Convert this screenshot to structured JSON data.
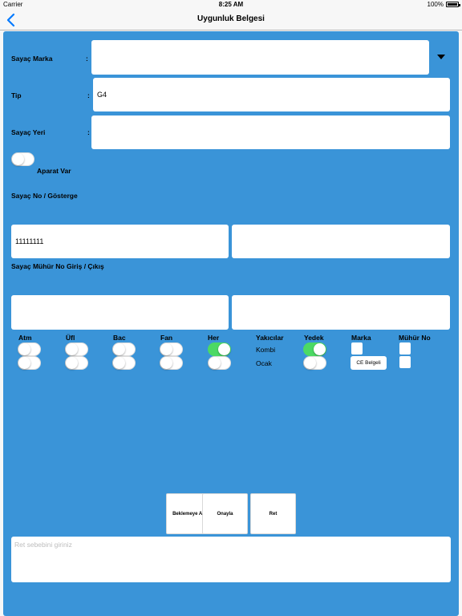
{
  "status_bar": {
    "carrier": "Carrier",
    "time": "8:25 AM",
    "battery": "100%",
    "battery_level": 1.0
  },
  "nav": {
    "title": "Uygunluk Belgesi",
    "back_icon": "chevron-left-icon"
  },
  "form": {
    "sayac_marka": {
      "label": "Sayaç Marka",
      "colon": ":",
      "value": ""
    },
    "tip": {
      "label": "Tip",
      "colon": ":",
      "value": "G4"
    },
    "sayac_yeri": {
      "label": "Sayaç Yeri",
      "colon": ":",
      "value": ""
    },
    "aparat": {
      "label": "Aparat Var",
      "on": false
    },
    "sayac_no": {
      "label": "Sayaç No / Gösterge",
      "no_value": "11111111",
      "gosterge_value": ""
    },
    "muhur": {
      "label": "Sayaç Mühür No Giriş / Çıkış",
      "giris_value": "",
      "cikis_value": ""
    }
  },
  "options": {
    "headers": {
      "atm": "Atm",
      "ufl": "Üfl",
      "bac": "Bac",
      "fan": "Fan",
      "her": "Her",
      "yakicilar": "Yakıcılar",
      "yedek": "Yedek",
      "marka": "Marka",
      "muhur_no": "Mühür No"
    },
    "rows": {
      "kombi": "Kombi",
      "ocak": "Ocak"
    },
    "toggles": {
      "atm": [
        false,
        false
      ],
      "ufl": [
        false,
        false
      ],
      "bac": [
        false,
        false
      ],
      "fan": [
        false,
        false
      ],
      "her": [
        true,
        false
      ],
      "yedek": [
        true,
        false
      ]
    },
    "ce_label": "CE Belgeli"
  },
  "actions": {
    "beklemeye_al": "Beklemeye Al",
    "onayla": "Onayla",
    "ret": "Ret"
  },
  "reason": {
    "placeholder": "Ret sebebini giriniz",
    "value": ""
  },
  "colors": {
    "background": "#3a94d8",
    "toggle_on": "#4cd964",
    "nav_accent": "#007aff"
  }
}
